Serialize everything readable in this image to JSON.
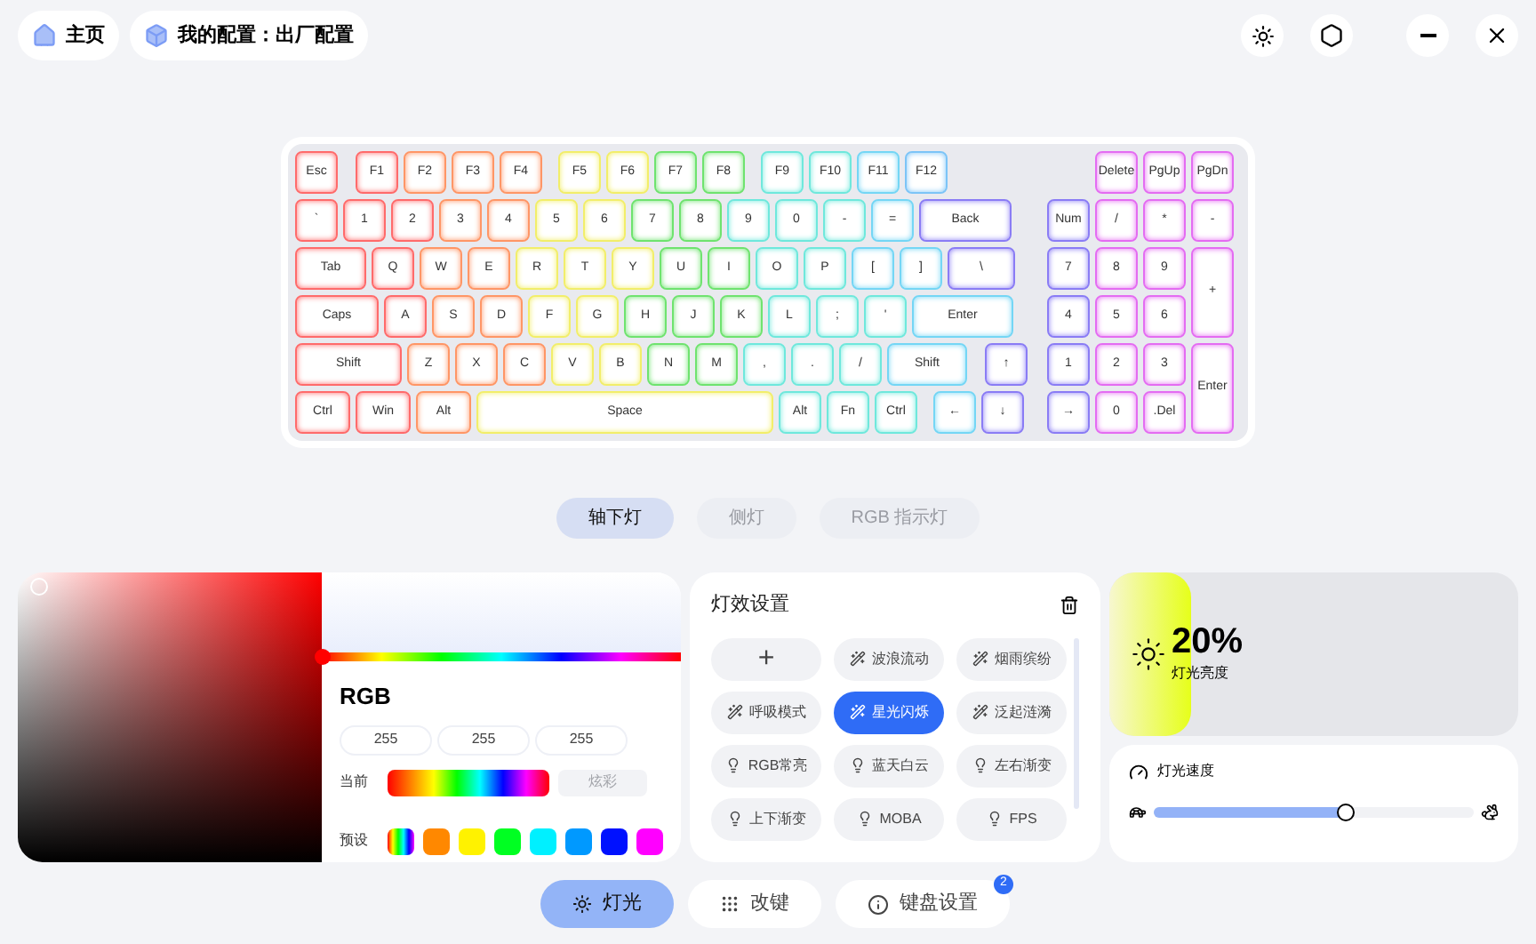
{
  "top_bar": {
    "home": "主页",
    "profile": "我的配置：出厂配置"
  },
  "keyboard": {
    "rows": [
      [
        {
          "label": "Esc",
          "color": "#ff6b6b"
        },
        {
          "label": "F1",
          "color": "#ff6b6b"
        },
        {
          "label": "F2",
          "color": "#ff9666"
        },
        {
          "label": "F3",
          "color": "#ff9666"
        },
        {
          "label": "F4",
          "color": "#ff9666"
        },
        {
          "label": "F5",
          "color": "#f2ee6a"
        },
        {
          "label": "F6",
          "color": "#f2ee6a"
        },
        {
          "label": "F7",
          "color": "#6fe36f"
        },
        {
          "label": "F8",
          "color": "#6fe36f"
        },
        {
          "label": "F9",
          "color": "#6fe8dc"
        },
        {
          "label": "F10",
          "color": "#6fe8dc"
        },
        {
          "label": "F11",
          "color": "#74d6f5"
        },
        {
          "label": "F12",
          "color": "#7cc4f7"
        }
      ],
      [
        {
          "label": "`",
          "color": "#ff6b6b"
        },
        {
          "label": "1",
          "color": "#ff6b6b"
        },
        {
          "label": "2",
          "color": "#ff6b6b"
        },
        {
          "label": "3",
          "color": "#ff9666"
        },
        {
          "label": "4",
          "color": "#ff9666"
        },
        {
          "label": "5",
          "color": "#f2ee6a"
        },
        {
          "label": "6",
          "color": "#f2ee6a"
        },
        {
          "label": "7",
          "color": "#6fe36f"
        },
        {
          "label": "8",
          "color": "#6fe36f"
        },
        {
          "label": "9",
          "color": "#6fe8dc"
        },
        {
          "label": "0",
          "color": "#6fe8dc"
        },
        {
          "label": "-",
          "color": "#6fe8dc"
        },
        {
          "label": "=",
          "color": "#74d6f5"
        },
        {
          "label": "Back",
          "color": "#8a7cf5"
        }
      ],
      [
        {
          "label": "Tab",
          "color": "#ff6b6b"
        },
        {
          "label": "Q",
          "color": "#ff6b6b"
        },
        {
          "label": "W",
          "color": "#ff9666"
        },
        {
          "label": "E",
          "color": "#ff9666"
        },
        {
          "label": "R",
          "color": "#f2ee6a"
        },
        {
          "label": "T",
          "color": "#f2ee6a"
        },
        {
          "label": "Y",
          "color": "#f2ee6a"
        },
        {
          "label": "U",
          "color": "#6fe36f"
        },
        {
          "label": "I",
          "color": "#6fe36f"
        },
        {
          "label": "O",
          "color": "#6fe8dc"
        },
        {
          "label": "P",
          "color": "#6fe8dc"
        },
        {
          "label": "[",
          "color": "#74d6f5"
        },
        {
          "label": "]",
          "color": "#74d6f5"
        },
        {
          "label": "\\",
          "color": "#8a7cf5"
        }
      ],
      [
        {
          "label": "Caps",
          "color": "#ff6b6b"
        },
        {
          "label": "A",
          "color": "#ff6b6b"
        },
        {
          "label": "S",
          "color": "#ff9666"
        },
        {
          "label": "D",
          "color": "#ff9666"
        },
        {
          "label": "F",
          "color": "#f2ee6a"
        },
        {
          "label": "G",
          "color": "#f2ee6a"
        },
        {
          "label": "H",
          "color": "#6fe36f"
        },
        {
          "label": "J",
          "color": "#6fe36f"
        },
        {
          "label": "K",
          "color": "#6fe36f"
        },
        {
          "label": "L",
          "color": "#6fe8dc"
        },
        {
          "label": ";",
          "color": "#6fe8dc"
        },
        {
          "label": "'",
          "color": "#6fe8dc"
        },
        {
          "label": "Enter",
          "color": "#74d6f5"
        }
      ],
      [
        {
          "label": "Shift",
          "color": "#ff6b6b"
        },
        {
          "label": "Z",
          "color": "#ff9666"
        },
        {
          "label": "X",
          "color": "#ff9666"
        },
        {
          "label": "C",
          "color": "#ff9666"
        },
        {
          "label": "V",
          "color": "#f2ee6a"
        },
        {
          "label": "B",
          "color": "#f2ee6a"
        },
        {
          "label": "N",
          "color": "#6fe36f"
        },
        {
          "label": "M",
          "color": "#6fe36f"
        },
        {
          "label": ",",
          "color": "#6fe8dc"
        },
        {
          "label": ".",
          "color": "#6fe8dc"
        },
        {
          "label": "/",
          "color": "#6fe8dc"
        },
        {
          "label": "Shift",
          "color": "#74d6f5"
        },
        {
          "label": "↑",
          "color": "#8a7cf5"
        }
      ],
      [
        {
          "label": "Ctrl",
          "color": "#ff6b6b"
        },
        {
          "label": "Win",
          "color": "#ff6b6b"
        },
        {
          "label": "Alt",
          "color": "#ff9666"
        },
        {
          "label": "Space",
          "color": "#f2ee6a"
        },
        {
          "label": "Alt",
          "color": "#6fe8dc"
        },
        {
          "label": "Fn",
          "color": "#6fe8dc"
        },
        {
          "label": "Ctrl",
          "color": "#6fe8dc"
        },
        {
          "label": "←",
          "color": "#74d6f5"
        },
        {
          "label": "↓",
          "color": "#8a7cf5"
        }
      ]
    ],
    "numpad": [
      {
        "label": "Delete",
        "color": "#e46cf2"
      },
      {
        "label": "PgUp",
        "color": "#e46cf2"
      },
      {
        "label": "PgDn",
        "color": "#e46cf2"
      },
      {
        "label": "Num",
        "color": "#8a7cf5"
      },
      {
        "label": "/",
        "color": "#e46cf2"
      },
      {
        "label": "*",
        "color": "#e46cf2"
      },
      {
        "label": "-",
        "color": "#e46cf2"
      },
      {
        "label": "7",
        "color": "#8a7cf5"
      },
      {
        "label": "8",
        "color": "#e46cf2"
      },
      {
        "label": "9",
        "color": "#e46cf2"
      },
      {
        "label": "+",
        "color": "#e46cf2"
      },
      {
        "label": "4",
        "color": "#8a7cf5"
      },
      {
        "label": "5",
        "color": "#e46cf2"
      },
      {
        "label": "6",
        "color": "#e46cf2"
      },
      {
        "label": "1",
        "color": "#8a7cf5"
      },
      {
        "label": "2",
        "color": "#e46cf2"
      },
      {
        "label": "3",
        "color": "#e46cf2"
      },
      {
        "label": "Enter",
        "color": "#e46cf2"
      },
      {
        "label": "→",
        "color": "#8a7cf5"
      },
      {
        "label": "0",
        "color": "#e46cf2"
      },
      {
        "label": ".Del",
        "color": "#e46cf2"
      }
    ]
  },
  "light_tabs": [
    {
      "label": "轴下灯",
      "selected": true
    },
    {
      "label": "侧灯",
      "selected": false
    },
    {
      "label": "RGB 指示灯",
      "selected": false
    }
  ],
  "color_picker": {
    "hue": {
      "level": 0
    },
    "mode": "RGB",
    "values": [
      "255",
      "255",
      "255"
    ],
    "current_label": "当前",
    "colorful_button": "炫彩",
    "presets_label": "预设",
    "presets": [
      {
        "kind": "rainbow"
      },
      {
        "kind": "solid",
        "color": "#ff8800"
      },
      {
        "kind": "solid",
        "color": "#fff200"
      },
      {
        "kind": "solid",
        "color": "#00ff22"
      },
      {
        "kind": "solid",
        "color": "#00f0ff"
      },
      {
        "kind": "solid",
        "color": "#0099ff"
      },
      {
        "kind": "solid",
        "color": "#0011ff"
      },
      {
        "kind": "solid",
        "color": "#ff00ff"
      }
    ]
  },
  "effects": {
    "title": "灯效设置",
    "items": [
      {
        "kind": "add",
        "label": "+",
        "selected": false
      },
      {
        "kind": "dynamic",
        "label": "波浪流动",
        "selected": false
      },
      {
        "kind": "dynamic",
        "label": "烟雨缤纷",
        "selected": false
      },
      {
        "kind": "dynamic",
        "label": "呼吸模式",
        "selected": false
      },
      {
        "kind": "dynamic",
        "label": "星光闪烁",
        "selected": true
      },
      {
        "kind": "dynamic",
        "label": "泛起涟漪",
        "selected": false
      },
      {
        "kind": "static",
        "label": "RGB常亮",
        "selected": false
      },
      {
        "kind": "static",
        "label": "蓝天白云",
        "selected": false
      },
      {
        "kind": "static",
        "label": "左右渐变",
        "selected": false
      },
      {
        "kind": "static",
        "label": "上下渐变",
        "selected": false
      },
      {
        "kind": "static",
        "label": "MOBA",
        "selected": false
      },
      {
        "kind": "static",
        "label": "FPS",
        "selected": false
      }
    ]
  },
  "brightness": {
    "value": "20%",
    "label": "灯光亮度",
    "level": 0.2
  },
  "speed": {
    "label": "灯光速度",
    "level": 0.6
  },
  "bottom_nav": [
    {
      "label": "灯光",
      "selected": true,
      "kind": "light"
    },
    {
      "label": "改键",
      "selected": false,
      "kind": "keys"
    },
    {
      "label": "键盘设置",
      "selected": false,
      "kind": "settings",
      "badge": "2"
    }
  ]
}
